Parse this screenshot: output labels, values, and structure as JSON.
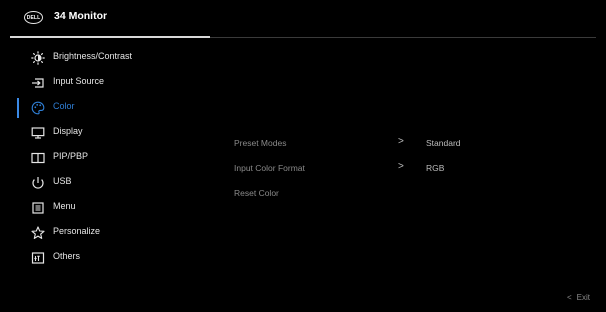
{
  "header": {
    "logo_text": "DELL",
    "title": "34 Monitor"
  },
  "menu": {
    "items": [
      {
        "label": "Brightness/Contrast",
        "icon": "brightness-icon"
      },
      {
        "label": "Input Source",
        "icon": "input-source-icon"
      },
      {
        "label": "Color",
        "icon": "color-palette-icon",
        "active": true
      },
      {
        "label": "Display",
        "icon": "display-icon"
      },
      {
        "label": "PIP/PBP",
        "icon": "pip-pbp-icon"
      },
      {
        "label": "USB",
        "icon": "usb-icon"
      },
      {
        "label": "Menu",
        "icon": "menu-icon"
      },
      {
        "label": "Personalize",
        "icon": "star-icon"
      },
      {
        "label": "Others",
        "icon": "others-icon"
      }
    ]
  },
  "panel": {
    "rows": [
      {
        "label": "Preset Modes",
        "chevron": ">",
        "value": "Standard"
      },
      {
        "label": "Input Color Format",
        "chevron": ">",
        "value": "RGB"
      },
      {
        "label": "Reset Color"
      }
    ]
  },
  "footer": {
    "exit_arrow": "<",
    "exit_label": "Exit"
  },
  "colors": {
    "background": "#000000",
    "accent": "#2f7fd6",
    "text": "#e6e6e6",
    "muted": "#8a8a8a"
  }
}
